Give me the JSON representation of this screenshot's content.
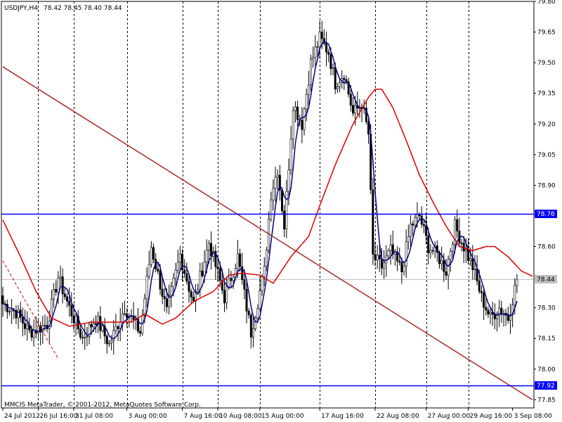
{
  "header": {
    "symbol": "USDJPY,H4",
    "ohlc": "78.42 78.45 78.40 78.44"
  },
  "footer": {
    "copyright": "MMCIS MetaTrader, © 2001-2012, MetaQuotes Software Corp."
  },
  "colors": {
    "background": "#ffffff",
    "bull": "#000000",
    "bear": "#000000",
    "fast_ma": "#000080",
    "slow_ma": "#e00000",
    "trendline": "#a52a2a",
    "hline": "#0000ff",
    "badge_bg": "#0000ff",
    "grid": "#000000"
  },
  "chart_data": {
    "type": "candlestick",
    "y_range": [
      77.81,
      79.8
    ],
    "y_ticks": [
      "79.80",
      "79.65",
      "79.50",
      "79.35",
      "79.20",
      "79.05",
      "78.90",
      "78.60",
      "78.30",
      "78.15",
      "78.00",
      "77.85"
    ],
    "x_labels": [
      "24 Jul 2012",
      "26 Jul 16:00",
      "31 Jul 08:00",
      "3 Aug 00:00",
      "7 Aug 16:00",
      "10 Aug 08:00",
      "15 Aug 00:00",
      "17 Aug 16:00",
      "22 Aug 08:00",
      "27 Aug 00:00",
      "29 Aug 16:00",
      "3 Sep 08:00"
    ],
    "separator_indices": [
      16,
      32,
      56,
      81,
      97,
      116,
      143,
      168,
      191,
      210
    ],
    "candle_count": 240,
    "hlines": [
      {
        "value": 78.76,
        "label": "78.76"
      },
      {
        "value": 77.92,
        "label": "77.92"
      }
    ],
    "current_price": {
      "value": 78.44,
      "label": "78.44"
    },
    "trendline": [
      {
        "index": 0,
        "value": 79.48
      },
      {
        "index": 239,
        "value": 77.85
      }
    ],
    "dashed_trendline": [
      {
        "index": 0,
        "value": 78.53
      },
      {
        "index": 25,
        "value": 78.05
      }
    ],
    "close_path": [
      [
        0,
        78.32
      ],
      [
        6,
        78.28
      ],
      [
        12,
        78.18
      ],
      [
        20,
        78.22
      ],
      [
        25,
        78.45
      ],
      [
        30,
        78.3
      ],
      [
        36,
        78.15
      ],
      [
        42,
        78.25
      ],
      [
        48,
        78.12
      ],
      [
        55,
        78.3
      ],
      [
        62,
        78.18
      ],
      [
        67,
        78.6
      ],
      [
        74,
        78.28
      ],
      [
        80,
        78.56
      ],
      [
        86,
        78.32
      ],
      [
        93,
        78.62
      ],
      [
        100,
        78.35
      ],
      [
        106,
        78.55
      ],
      [
        112,
        78.18
      ],
      [
        118,
        78.48
      ],
      [
        121,
        78.86
      ],
      [
        124,
        78.98
      ],
      [
        127,
        78.7
      ],
      [
        131,
        79.3
      ],
      [
        135,
        79.2
      ],
      [
        139,
        79.5
      ],
      [
        143,
        79.62
      ],
      [
        147,
        79.55
      ],
      [
        150,
        79.4
      ],
      [
        154,
        79.45
      ],
      [
        158,
        79.25
      ],
      [
        162,
        79.3
      ],
      [
        165,
        79.15
      ],
      [
        167,
        78.55
      ],
      [
        171,
        78.5
      ],
      [
        175,
        78.58
      ],
      [
        180,
        78.48
      ],
      [
        184,
        78.7
      ],
      [
        188,
        78.75
      ],
      [
        192,
        78.6
      ],
      [
        196,
        78.56
      ],
      [
        200,
        78.48
      ],
      [
        204,
        78.7
      ],
      [
        208,
        78.6
      ],
      [
        212,
        78.5
      ],
      [
        216,
        78.35
      ],
      [
        220,
        78.25
      ],
      [
        224,
        78.3
      ],
      [
        228,
        78.25
      ],
      [
        232,
        78.44
      ]
    ],
    "series": [
      {
        "type": "candlestick"
      },
      {
        "type": "line",
        "role": "fast_ma"
      },
      {
        "type": "line",
        "role": "slow_ma",
        "path": [
          [
            0,
            78.73
          ],
          [
            8,
            78.55
          ],
          [
            15,
            78.38
          ],
          [
            22,
            78.25
          ],
          [
            30,
            78.21
          ],
          [
            40,
            78.23
          ],
          [
            50,
            78.23
          ],
          [
            58,
            78.23
          ],
          [
            64,
            78.27
          ],
          [
            72,
            78.22
          ],
          [
            78,
            78.25
          ],
          [
            86,
            78.33
          ],
          [
            95,
            78.38
          ],
          [
            102,
            78.46
          ],
          [
            108,
            78.47
          ],
          [
            116,
            78.46
          ],
          [
            122,
            78.42
          ],
          [
            130,
            78.55
          ],
          [
            138,
            78.65
          ],
          [
            143,
            78.8
          ],
          [
            150,
            79.0
          ],
          [
            158,
            79.2
          ],
          [
            165,
            79.33
          ],
          [
            168,
            79.37
          ],
          [
            171,
            79.37
          ],
          [
            176,
            79.28
          ],
          [
            182,
            79.12
          ],
          [
            188,
            78.95
          ],
          [
            194,
            78.82
          ],
          [
            200,
            78.7
          ],
          [
            206,
            78.6
          ],
          [
            212,
            78.58
          ],
          [
            218,
            78.6
          ],
          [
            222,
            78.6
          ],
          [
            228,
            78.55
          ],
          [
            234,
            78.48
          ],
          [
            240,
            78.45
          ]
        ]
      }
    ]
  }
}
